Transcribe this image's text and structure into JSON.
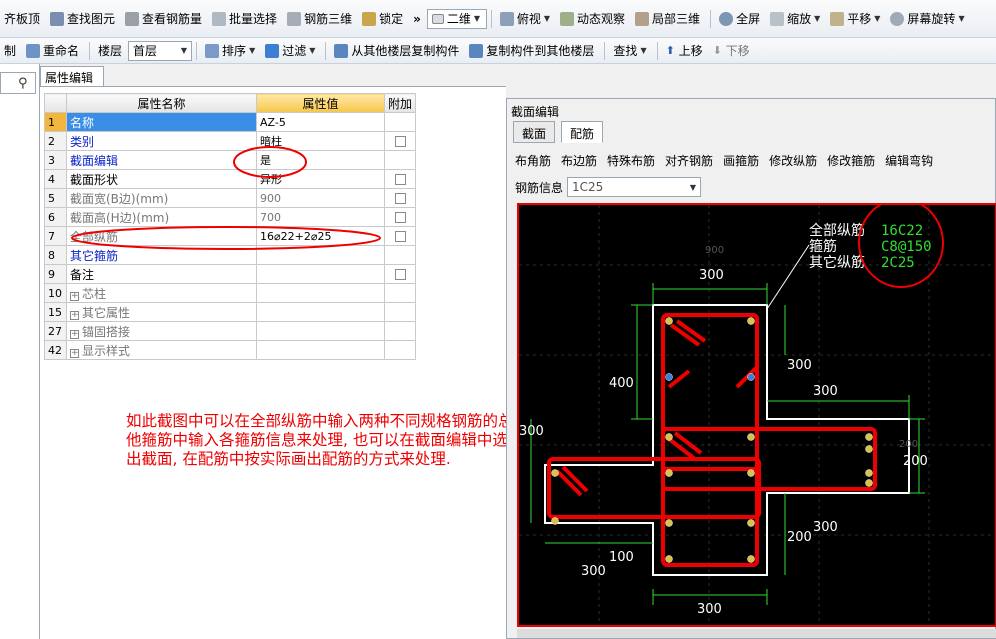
{
  "toolbar1": {
    "items": [
      "齐板顶",
      "查找图元",
      "查看钢筋量",
      "批量选择",
      "钢筋三维",
      "锁定"
    ],
    "overflow": "»",
    "view_mode": "二维",
    "items2": [
      "俯视",
      "动态观察",
      "局部三维",
      "全屏",
      "缩放",
      "平移",
      "屏幕旋转"
    ]
  },
  "toolbar2": {
    "items_a": [
      "制",
      "重命名"
    ],
    "floor_label": "楼层",
    "floor_value": "首层",
    "items_b": [
      "排序",
      "过滤",
      "从其他楼层复制构件",
      "复制构件到其他楼层",
      "查找",
      "上移",
      "下移"
    ]
  },
  "left": {
    "search_icon": "search-icon"
  },
  "prop_tab": "属性编辑",
  "grid": {
    "headers": [
      "属性名称",
      "属性值",
      "附加"
    ],
    "rows": [
      {
        "idx": "1",
        "name": "名称",
        "value": "AZ-5",
        "check": false
      },
      {
        "idx": "2",
        "name": "类别",
        "value": "暗柱",
        "check": true
      },
      {
        "idx": "3",
        "name": "截面编辑",
        "value": "是",
        "check": false
      },
      {
        "idx": "4",
        "name": "截面形状",
        "value": "异形",
        "check": true
      },
      {
        "idx": "5",
        "name": "截面宽(B边)(mm)",
        "value": "900",
        "check": true
      },
      {
        "idx": "6",
        "name": "截面高(H边)(mm)",
        "value": "700",
        "check": true
      },
      {
        "idx": "7",
        "name": "全部纵筋",
        "value": "16⌀22+2⌀25",
        "check": true
      },
      {
        "idx": "8",
        "name": "其它箍筋",
        "value": "",
        "check": false
      },
      {
        "idx": "9",
        "name": "备注",
        "value": "",
        "check": true
      },
      {
        "idx": "10",
        "name": "芯柱",
        "value": "",
        "check": false
      },
      {
        "idx": "15",
        "name": "其它属性",
        "value": "",
        "check": false
      },
      {
        "idx": "27",
        "name": "锚固搭接",
        "value": "",
        "check": false
      },
      {
        "idx": "42",
        "name": "显示样式",
        "value": "",
        "check": false
      }
    ]
  },
  "note": "如此截图中可以在全部纵筋中输入两种不同规格钢筋的总数, 然后在其他箍筋中输入各箍筋信息来处理, 也可以在截面编辑中选择是, 然后画出截面, 在配筋中按实际画出配筋的方式来处理.",
  "section_editor": {
    "title": "截面编辑",
    "tabs": [
      "截面",
      "配筋"
    ],
    "tools": [
      "布角筋",
      "布边筋",
      "特殊布筋",
      "对齐钢筋",
      "画箍筋",
      "修改纵筋",
      "修改箍筋",
      "编辑弯钩"
    ],
    "rebar_info_label": "钢筋信息",
    "rebar_info_value": "1C25",
    "legend": [
      {
        "label": "全部纵筋",
        "value": "16C22"
      },
      {
        "label": "箍筋",
        "value": "C8@150"
      },
      {
        "label": "其它纵筋",
        "value": "2C25"
      }
    ],
    "dims": {
      "top": "300",
      "top_faint": "900",
      "r1": "300",
      "r2": "300",
      "left1": "400",
      "left2": "300",
      "right_h": "200",
      "right_faint": "200",
      "low_right": "300",
      "low_right2": "200",
      "bottom_left": "100",
      "bottom_left2": "300",
      "bottom": "300"
    }
  },
  "colors": {
    "highlight": "#ee0000",
    "selected_row": "#3a8ee6",
    "legend_green": "#33dd33"
  }
}
